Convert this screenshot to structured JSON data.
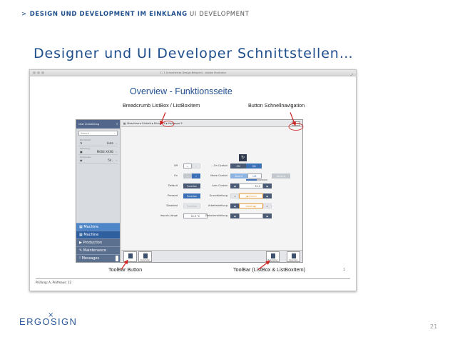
{
  "slide": {
    "breadcrumb_bold": "DESIGN UND DEVELOPMENT IM EINKLANG",
    "breadcrumb_rest": "UI DEVELOPMENT",
    "title": "Designer und UI Developer Schnittstellen…",
    "page_number": "21",
    "logo_text": "ERGOSIGN",
    "logo_mark": "×"
  },
  "screenshot": {
    "window_title": "1 / 1 (Annotiertes Design-Beispiel) – Adobe Illustrator",
    "heading": "Overview - Funktionsseite",
    "annotations": {
      "breadcrumb": "Breadcrumb ListBox / ListBoxItem",
      "quicknav": "Button Schnellnavigation",
      "toolbar_button": "ToolBar Button",
      "toolbar_listbox": "ToolBar (ListBox & ListBoxItem)"
    },
    "page_marker": "1",
    "footer_text": "Prüfung: A, Prüfmaus: 12",
    "annotation_color": "#d02020"
  },
  "app": {
    "sidebar": {
      "user": "User Anmeldung",
      "search_placeholder": "Search",
      "rows": [
        {
          "sub": "Betriebsart",
          "icon": "⇅",
          "value": "Auto"
        },
        {
          "sub": "Werkzeug",
          "icon": "▣",
          "value": "M004 XXXB"
        },
        {
          "sub": "Temperatur",
          "icon": "◉",
          "value": "54.."
        }
      ],
      "nav": [
        {
          "label": "Machine",
          "state": "hl"
        },
        {
          "label": "Machine",
          "state": "sel"
        },
        {
          "label": "Production",
          "state": "normal"
        },
        {
          "label": "Maintenance",
          "state": "normal"
        },
        {
          "label": "Messages",
          "state": "normal"
        }
      ]
    },
    "breadcrumb": {
      "text": "Maschine  ▸  Einheit  ▸  Einheit 4  ▸  Heizzone 5",
      "button": "Schnell"
    },
    "left_controls": [
      {
        "label": "Off",
        "buttons": [
          "—",
          "✓"
        ]
      },
      {
        "label": "On",
        "buttons": [
          "—",
          "✓"
        ]
      },
      {
        "label": "Default",
        "buttons": [
          "Function"
        ]
      },
      {
        "label": "Pressed",
        "buttons": [
          "Function"
        ]
      },
      {
        "label": "Disabled",
        "buttons": [
          "Function"
        ]
      },
      {
        "label": "Impuls-Länge",
        "value": "21.5 °C"
      }
    ],
    "right_controls": [
      {
        "label": "...On Control",
        "buttons": [
          "ON",
          "ON"
        ]
      },
      {
        "label": "Move Control",
        "buttons": [
          "Start H",
          "Lift",
          "Go to A"
        ]
      },
      {
        "label": "Axis Control",
        "value": "21.2"
      },
      {
        "label": "Grundstellung",
        "value": "Grund"
      },
      {
        "label": "Arbeitsstellung",
        "value": "Arbeit"
      },
      {
        "label": "Zwischenstellung",
        "value": ""
      }
    ],
    "toolbar": {
      "left_button": "Parameter",
      "right_buttons": [
        "Bearbeiten",
        "Speichern"
      ]
    }
  }
}
